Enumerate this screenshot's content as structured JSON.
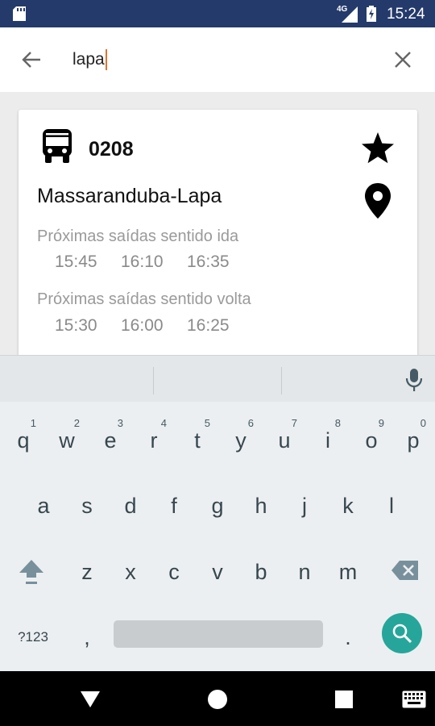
{
  "status_bar": {
    "network": "4G",
    "time": "15:24"
  },
  "search": {
    "query": "lapa"
  },
  "result_card": {
    "route_code": "0208",
    "route_name": "Massaranduba-Lapa",
    "outbound_label": "Próximas saídas sentido ida",
    "outbound_times": [
      "15:45",
      "16:10",
      "16:35"
    ],
    "return_label": "Próximas saídas sentido volta",
    "return_times": [
      "15:30",
      "16:00",
      "16:25"
    ]
  },
  "keyboard": {
    "row1": [
      {
        "key": "q",
        "num": "1"
      },
      {
        "key": "w",
        "num": "2"
      },
      {
        "key": "e",
        "num": "3"
      },
      {
        "key": "r",
        "num": "4"
      },
      {
        "key": "t",
        "num": "5"
      },
      {
        "key": "y",
        "num": "6"
      },
      {
        "key": "u",
        "num": "7"
      },
      {
        "key": "i",
        "num": "8"
      },
      {
        "key": "o",
        "num": "9"
      },
      {
        "key": "p",
        "num": "0"
      }
    ],
    "row2": [
      "a",
      "s",
      "d",
      "f",
      "g",
      "h",
      "j",
      "k",
      "l"
    ],
    "row3": [
      "z",
      "x",
      "c",
      "v",
      "b",
      "n",
      "m"
    ],
    "symbols_label": "?123",
    "comma": ",",
    "period": "."
  },
  "icons": {
    "back": "arrow-left-icon",
    "clear": "close-icon",
    "bus": "bus-icon",
    "favorite": "star-icon",
    "map": "map-pin-icon",
    "mic": "microphone-icon",
    "shift": "shift-icon",
    "backspace": "backspace-icon",
    "search": "search-icon"
  },
  "colors": {
    "status_bar": "#243a6a",
    "caret": "#e0752b",
    "search_key": "#26a69a"
  }
}
